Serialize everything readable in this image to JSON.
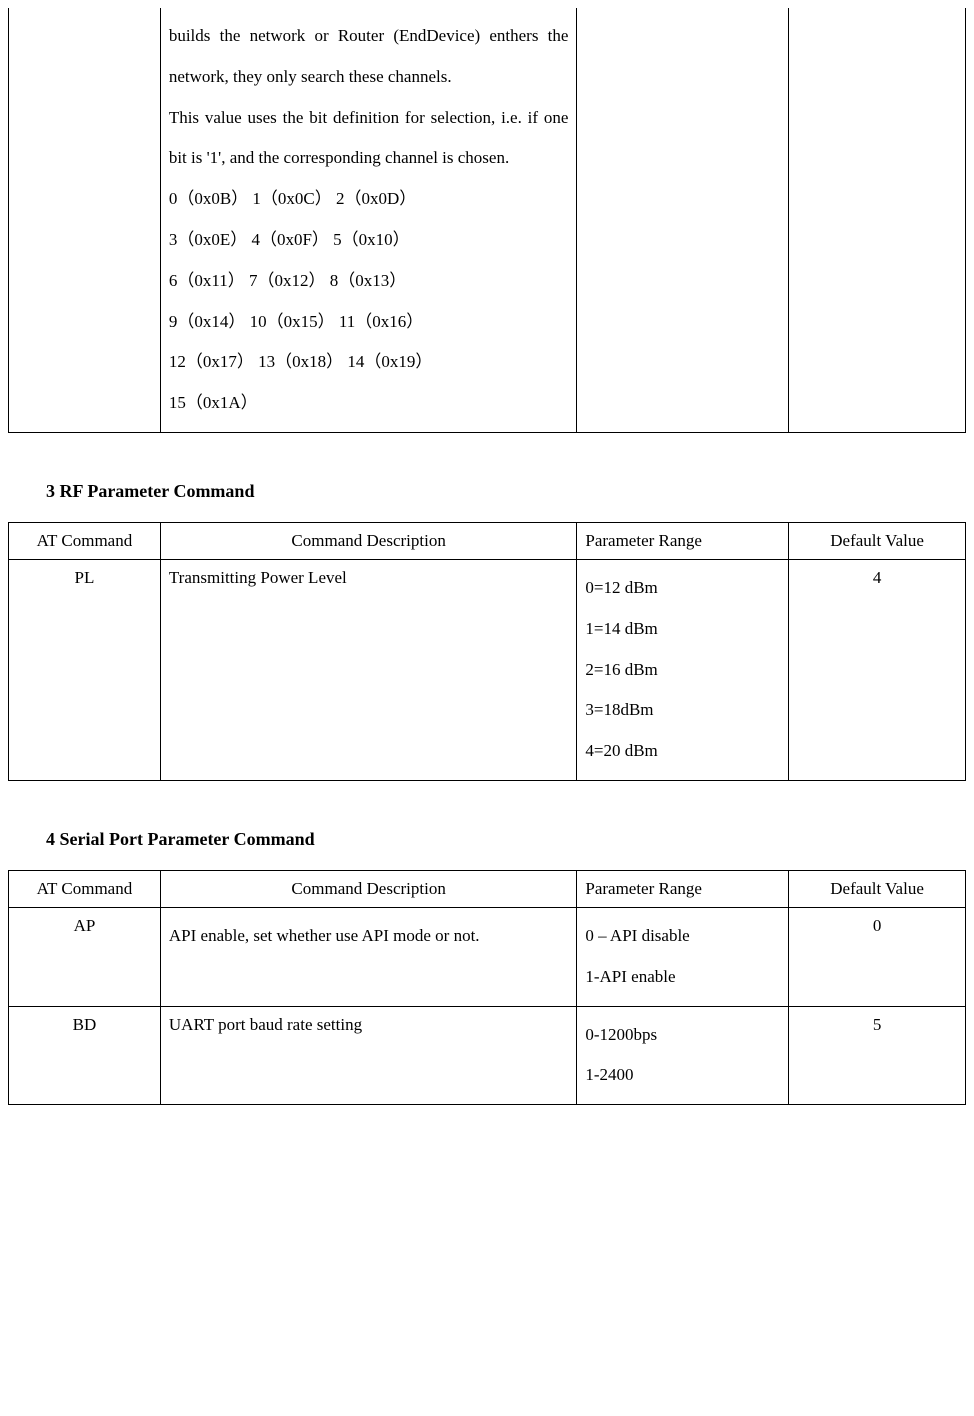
{
  "fragment_table": {
    "description_lines": [
      "builds the network or Router (EndDevice) enthers the network, they only search these channels.",
      "This value uses the bit definition for selection, i.e. if one bit is '1', and the corresponding channel is chosen."
    ],
    "bit_rows": [
      "0（0x0B）  1（0x0C）  2（0x0D）",
      "3（0x0E）  4（0x0F）  5（0x10）",
      "6（0x11）  7（0x12）   8（0x13）",
      "9（0x14）  10（0x15）  11（0x16）",
      "12（0x17） 13（0x18）  14（0x19）",
      "15（0x1A）"
    ]
  },
  "section3": {
    "heading": "3 RF Parameter Command",
    "headers": {
      "cmd": "AT Command",
      "desc": "Command Description",
      "range": "Parameter Range",
      "default": "Default Value"
    },
    "row": {
      "cmd": "PL",
      "desc": "Transmitting Power Level",
      "range": [
        "0=12 dBm",
        "1=14 dBm",
        "2=16 dBm",
        "3=18dBm",
        "4=20 dBm"
      ],
      "default": "4"
    }
  },
  "section4": {
    "heading": "4 Serial Port Parameter Command",
    "headers": {
      "cmd": "AT Command",
      "desc": "Command Description",
      "range": "Parameter Range",
      "default": "Default Value"
    },
    "rows": [
      {
        "cmd": "AP",
        "desc": "API enable, set whether use API mode or not.",
        "range": [
          "0 – API disable",
          "1-API enable"
        ],
        "default": "0"
      },
      {
        "cmd": "BD",
        "desc": "UART port baud rate setting",
        "range": [
          "0-1200bps",
          "1-2400"
        ],
        "default": "5"
      }
    ]
  }
}
